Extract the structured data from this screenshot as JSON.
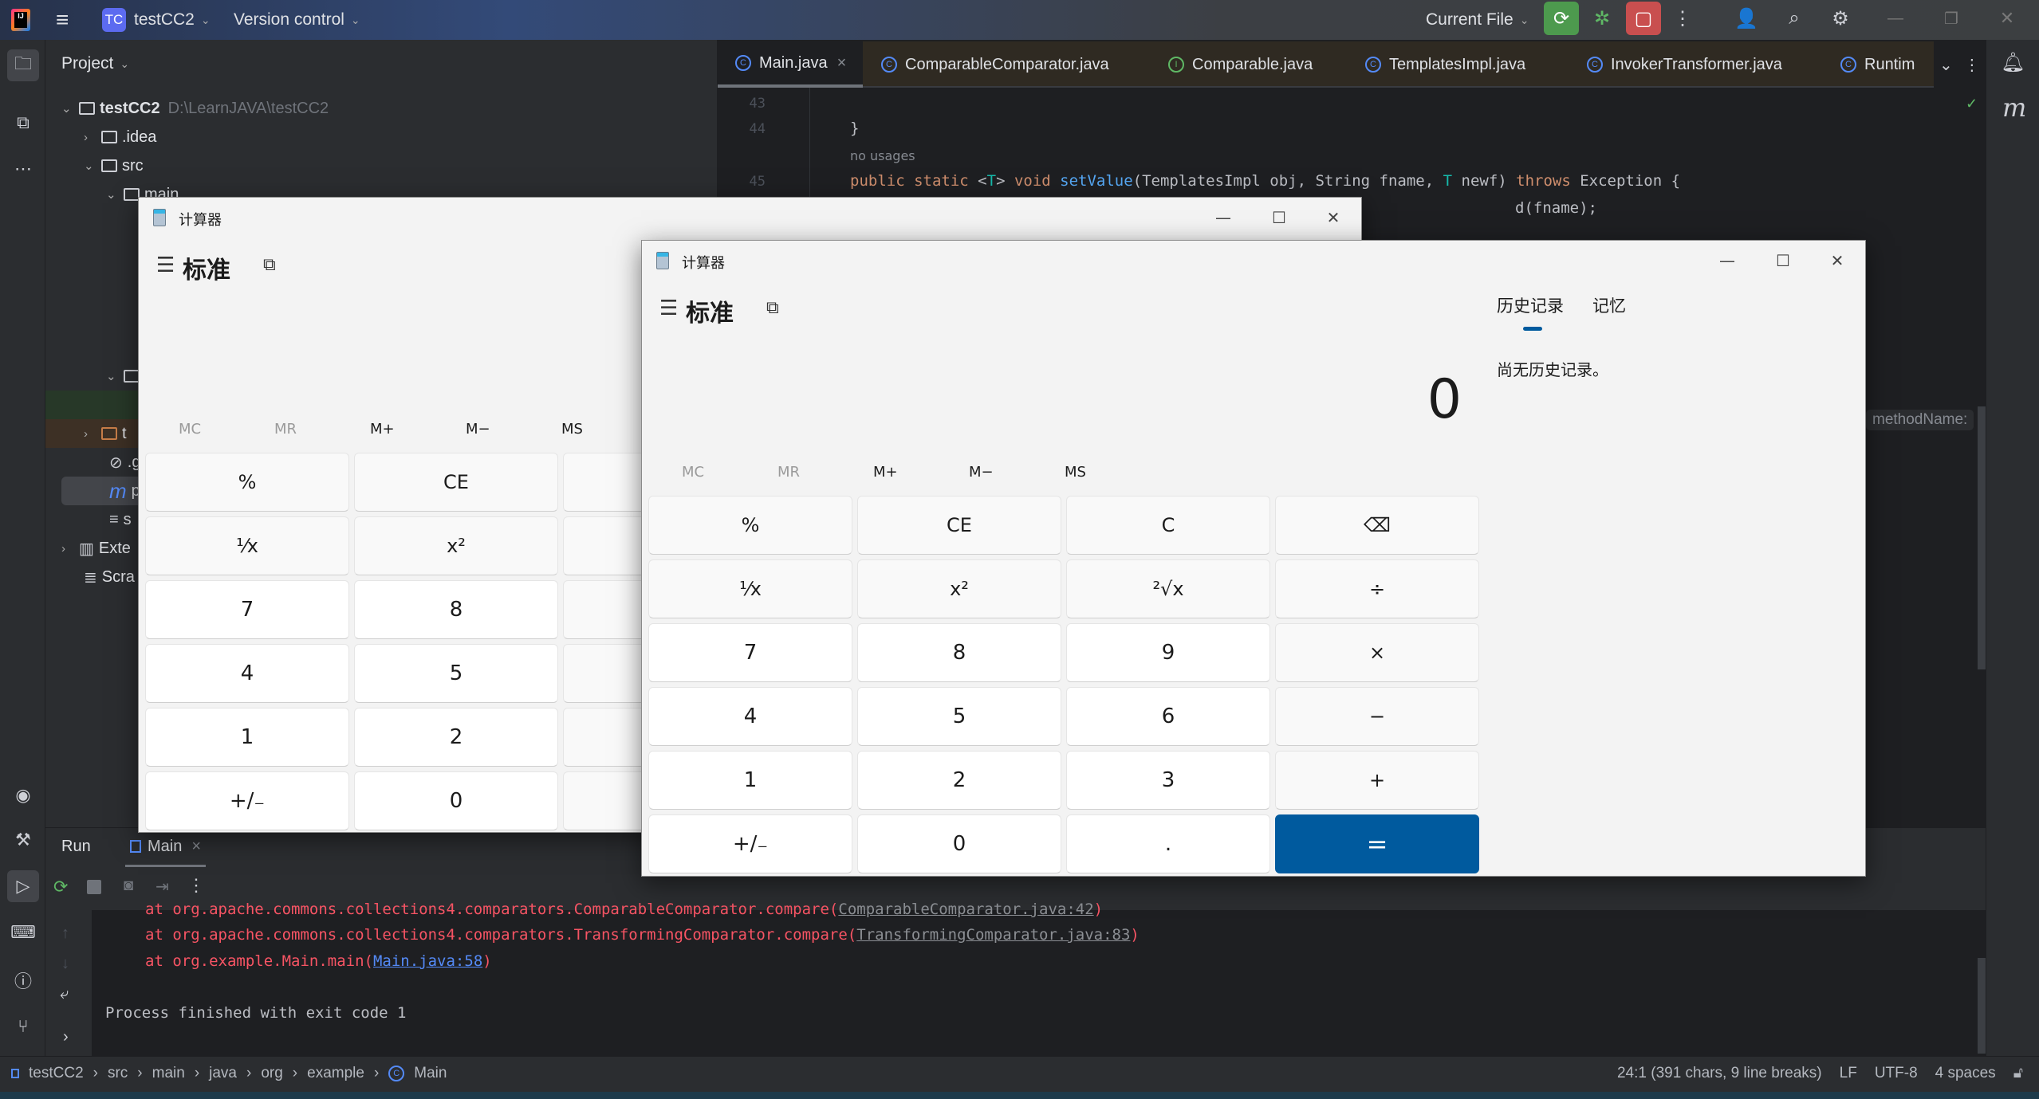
{
  "titlebar": {
    "project_badge": "TC",
    "project_name": "testCC2",
    "vcs_label": "Version control",
    "run_config": "Current File"
  },
  "project_panel": {
    "title": "Project",
    "tree": [
      {
        "label": "testCC2",
        "path": "D:\\LearnJAVA\\testCC2",
        "expanded": true
      },
      {
        "label": ".idea",
        "expanded": false
      },
      {
        "label": "src",
        "expanded": true
      },
      {
        "label": "main",
        "expanded": true
      },
      {
        "label": "t",
        "expanded": false
      },
      {
        "label": ".g"
      },
      {
        "label": "p"
      },
      {
        "label": "s"
      },
      {
        "label": "Exte",
        "expanded": false
      },
      {
        "label": "Scra"
      }
    ]
  },
  "editor": {
    "tabs": [
      {
        "label": "Main.java",
        "kind": "class",
        "active": true
      },
      {
        "label": "ComparableComparator.java",
        "kind": "class"
      },
      {
        "label": "Comparable.java",
        "kind": "interface"
      },
      {
        "label": "TemplatesImpl.java",
        "kind": "class"
      },
      {
        "label": "InvokerTransformer.java",
        "kind": "class"
      },
      {
        "label": "Runtim",
        "kind": "class"
      }
    ],
    "lines": [
      {
        "num": "43",
        "text": ""
      },
      {
        "num": "44",
        "text": "}"
      },
      {
        "num": "",
        "text": "no usages"
      },
      {
        "num": "45",
        "text": "public static <T> void setValue(TemplatesImpl obj, String fname, T newf) throws Exception {"
      },
      {
        "num": "",
        "text": "d(fname);"
      }
    ],
    "inlay_hint": "methodName:"
  },
  "run_panel": {
    "title": "Run",
    "tab": "Main",
    "console": [
      {
        "prefix": "at org.apache.commons.collections4.comparators.ComparableComparator.compare(",
        "link": "ComparableComparator.java:42",
        "suffix": ")"
      },
      {
        "prefix": "at org.apache.commons.collections4.comparators.TransformingComparator.compare(",
        "link": "TransformingComparator.java:83",
        "suffix": ")"
      },
      {
        "prefix": "at org.example.Main.main(",
        "link": "Main.java:58",
        "suffix": ")"
      }
    ],
    "exit_message": "Process finished with exit code 1"
  },
  "statusbar": {
    "breadcrumb": [
      "testCC2",
      "src",
      "main",
      "java",
      "org",
      "example",
      "Main"
    ],
    "position": "24:1 (391 chars, 9 line breaks)",
    "line_sep": "LF",
    "encoding": "UTF-8",
    "indent": "4 spaces"
  },
  "calc_back": {
    "title": "计算器",
    "mode": "标准",
    "memory": [
      "MC",
      "MR",
      "M+",
      "M−",
      "MS"
    ],
    "keys": [
      "%",
      "CE",
      "¹⁄x",
      "x²",
      "7",
      "8",
      "4",
      "5",
      "1",
      "2",
      "+/₋",
      "0"
    ]
  },
  "calc_front": {
    "title": "计算器",
    "mode": "标准",
    "display": "0",
    "history_tab": "历史记录",
    "memory_tab": "记忆",
    "history_empty": "尚无历史记录。",
    "memory": [
      "MC",
      "MR",
      "M+",
      "M−",
      "MS"
    ],
    "keys": [
      [
        "%",
        "CE",
        "C",
        "⌫"
      ],
      [
        "¹⁄x",
        "x²",
        "²√x",
        "÷"
      ],
      [
        "7",
        "8",
        "9",
        "×"
      ],
      [
        "4",
        "5",
        "6",
        "−"
      ],
      [
        "1",
        "2",
        "3",
        "+"
      ],
      [
        "+/₋",
        "0",
        ".",
        "="
      ]
    ],
    "accent": "#005a9e"
  }
}
